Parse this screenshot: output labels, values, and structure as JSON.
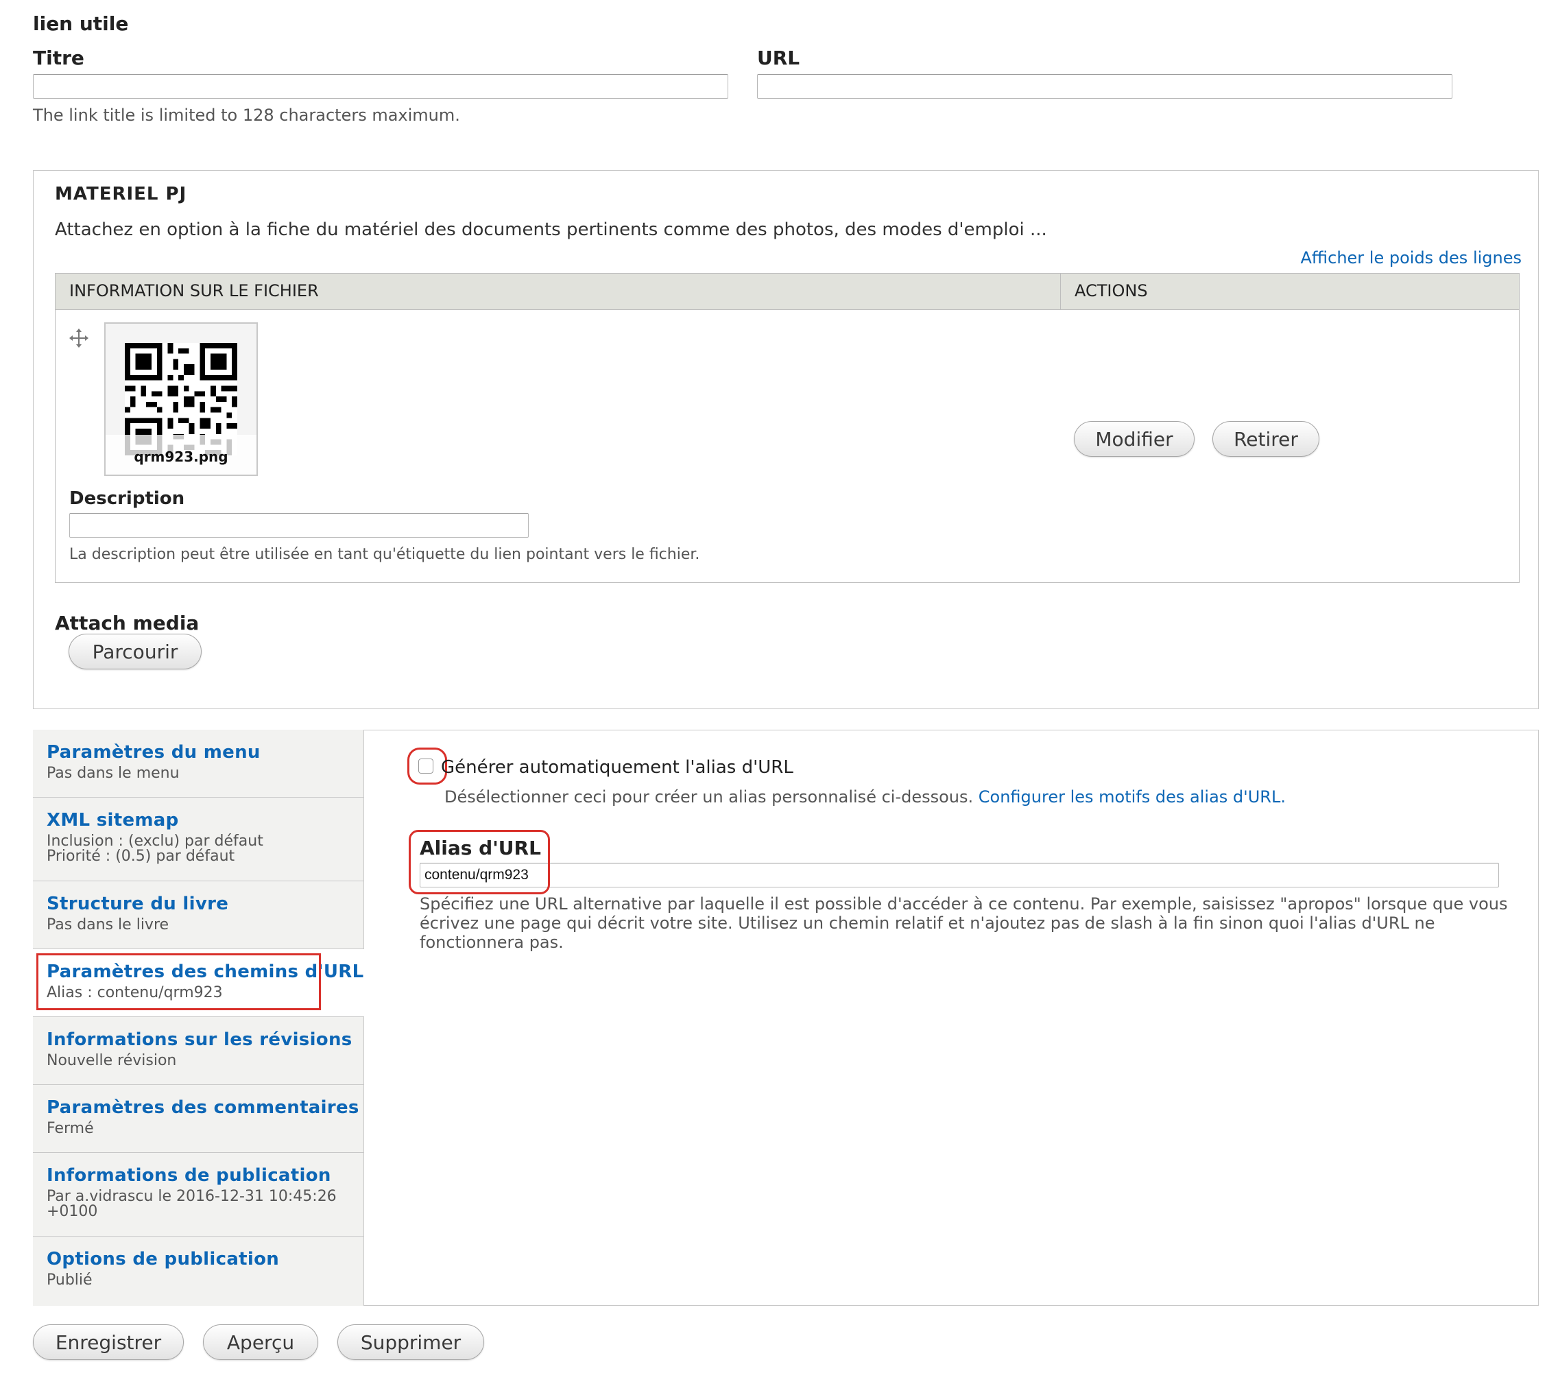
{
  "link_field": {
    "heading": "lien utile",
    "title_label": "Titre",
    "url_label": "URL",
    "title_value": "",
    "url_value": "",
    "help": "The link title is limited to 128 characters maximum."
  },
  "attachments": {
    "heading": "MATERIEL PJ",
    "description": "Attachez en option à la fiche du matériel des documents pertinents comme des photos, des modes d'emploi ...",
    "show_weights_link": "Afficher le poids des lignes",
    "table": {
      "col_file": "INFORMATION SUR LE FICHIER",
      "col_actions": "ACTIONS"
    },
    "file": {
      "name": "qrm923.png",
      "description_label": "Description",
      "description_value": "",
      "description_help": "La description peut être utilisée en tant qu'étiquette du lien pointant vers le fichier.",
      "modify_button": "Modifier",
      "remove_button": "Retirer"
    },
    "attach_media_label": "Attach media",
    "browse_button": "Parcourir"
  },
  "vertical_tabs": [
    {
      "title": "Paramètres du menu",
      "summary": [
        "Pas dans le menu"
      ]
    },
    {
      "title": "XML sitemap",
      "summary": [
        "Inclusion : (exclu) par défaut",
        "Priorité : (0.5) par défaut"
      ]
    },
    {
      "title": "Structure du livre",
      "summary": [
        "Pas dans le livre"
      ]
    },
    {
      "title": "Paramètres des chemins d'URL",
      "summary": [
        "Alias : contenu/qrm923"
      ]
    },
    {
      "title": "Informations sur les révisions",
      "summary": [
        "Nouvelle révision"
      ]
    },
    {
      "title": "Paramètres des commentaires",
      "summary": [
        "Fermé"
      ]
    },
    {
      "title": "Informations de publication",
      "summary": [
        "Par a.vidrascu le 2016-12-31 10:45:26",
        "+0100"
      ]
    },
    {
      "title": "Options de publication",
      "summary": [
        "Publié"
      ]
    }
  ],
  "url_panel": {
    "auto_alias_label": "Générer automatiquement l'alias d'URL",
    "auto_alias_checked": false,
    "auto_alias_help": "Désélectionner ceci pour créer un alias personnalisé ci-dessous.",
    "patterns_link": "Configurer les motifs des alias d'URL.",
    "alias_label": "Alias d'URL",
    "alias_value": "contenu/qrm923",
    "alias_help_lines": [
      "Spécifiez une URL alternative par laquelle il est possible d'accéder à ce contenu. Par exemple, saisissez \"apropos\" lorsque que vous",
      "écrivez une page qui décrit votre site. Utilisez un chemin relatif et n'ajoutez pas de slash à la fin sinon quoi l'alias d'URL ne",
      "fonctionnera pas."
    ]
  },
  "actions": {
    "save": "Enregistrer",
    "preview": "Aperçu",
    "delete": "Supprimer"
  },
  "colors": {
    "link": "#0d66b5",
    "highlight": "#d9302a",
    "table_header": "#e1e2dc",
    "tab_bg": "#f2f2f0"
  }
}
